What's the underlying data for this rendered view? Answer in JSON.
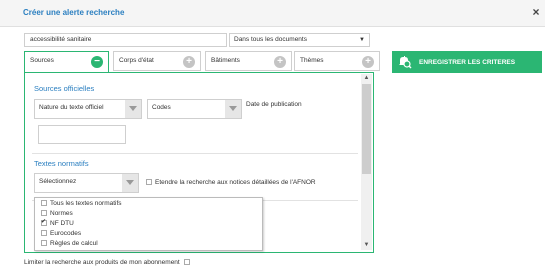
{
  "dialog": {
    "title": "Créer une alerte recherche",
    "close_label": "×"
  },
  "search": {
    "value": "accessibilité sanitaire",
    "scope_value": "Dans tous les documents"
  },
  "tabs": [
    {
      "label": "Sources",
      "icon": "minus-circle-icon",
      "active": true
    },
    {
      "label": "Corps d'état",
      "icon": "plus-circle-icon",
      "active": false
    },
    {
      "label": "Bâtiments",
      "icon": "plus-circle-icon",
      "active": false
    },
    {
      "label": "Thèmes",
      "icon": "plus-circle-icon",
      "active": false
    }
  ],
  "sources_officielles": {
    "heading": "Sources officielles",
    "nature_value": "Nature du texte officiel",
    "codes_value": "Codes",
    "date_label": "Date de publication",
    "date_value": ""
  },
  "textes_normatifs": {
    "heading": "Textes normatifs",
    "select_value": "Sélectionnez",
    "extend_label": "Etendre la recherche aux notices détaillées de l'AFNOR",
    "options": [
      {
        "label": "Tous les textes normatifs",
        "checked": false
      },
      {
        "label": "Normes",
        "checked": false
      },
      {
        "label": "NF DTU",
        "checked": true
      },
      {
        "label": "Eurocodes",
        "checked": false
      },
      {
        "label": "Règles de calcul",
        "checked": false
      }
    ]
  },
  "save_button": {
    "label": "ENREGISTRER LES CRITERES",
    "icon": "search-alert-icon"
  },
  "footer": {
    "limit_label": "Limiter la recherche aux produits de mon abonnement"
  },
  "colors": {
    "accent_green": "#2bb673",
    "title_blue": "#2b7fc0"
  }
}
